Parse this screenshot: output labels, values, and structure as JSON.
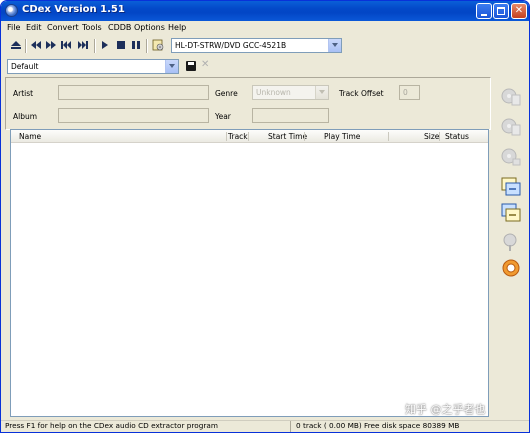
{
  "window": {
    "title": "CDex Version 1.51"
  },
  "menu": [
    "File",
    "Edit",
    "Convert",
    "Tools",
    "CDDB",
    "Options",
    "Help"
  ],
  "toolbar": {
    "drive_value": "HL-DT-STRW/DVD GCC-4521B",
    "profile_value": "Default"
  },
  "info": {
    "artist_label": "Artist",
    "album_label": "Album",
    "genre_label": "Genre",
    "genre_value": "Unknown",
    "year_label": "Year",
    "track_offset_label": "Track Offset",
    "track_offset_value": "0"
  },
  "track_list": {
    "columns": [
      "Name",
      "Track",
      "Start Time",
      "Play Time",
      "Size",
      "Status"
    ],
    "rows": []
  },
  "status": {
    "help_text": "Press F1 for help on the CDex audio CD extractor program",
    "disk_info": "0 track ( 0.00 MB) Free disk space 80389 MB"
  },
  "watermark": "知乎 @之乎者也",
  "icons": {
    "toolbar": [
      "eject-icon",
      "previous-track-icon",
      "rewind-icon",
      "fast-forward-icon",
      "next-track-icon",
      "play-icon",
      "stop-icon",
      "pause-icon",
      "cd-info-icon"
    ],
    "sidebar": [
      "extract-to-wav-icon",
      "extract-to-mp3-icon",
      "extract-partial-icon",
      "convert-wav-to-mp3-icon",
      "convert-mp3-to-wav-icon",
      "record-icon",
      "settings-icon"
    ]
  },
  "colors": {
    "title_bar": "#0348c8",
    "window_bg": "#ece9d8",
    "field_border": "#7f9db9"
  }
}
